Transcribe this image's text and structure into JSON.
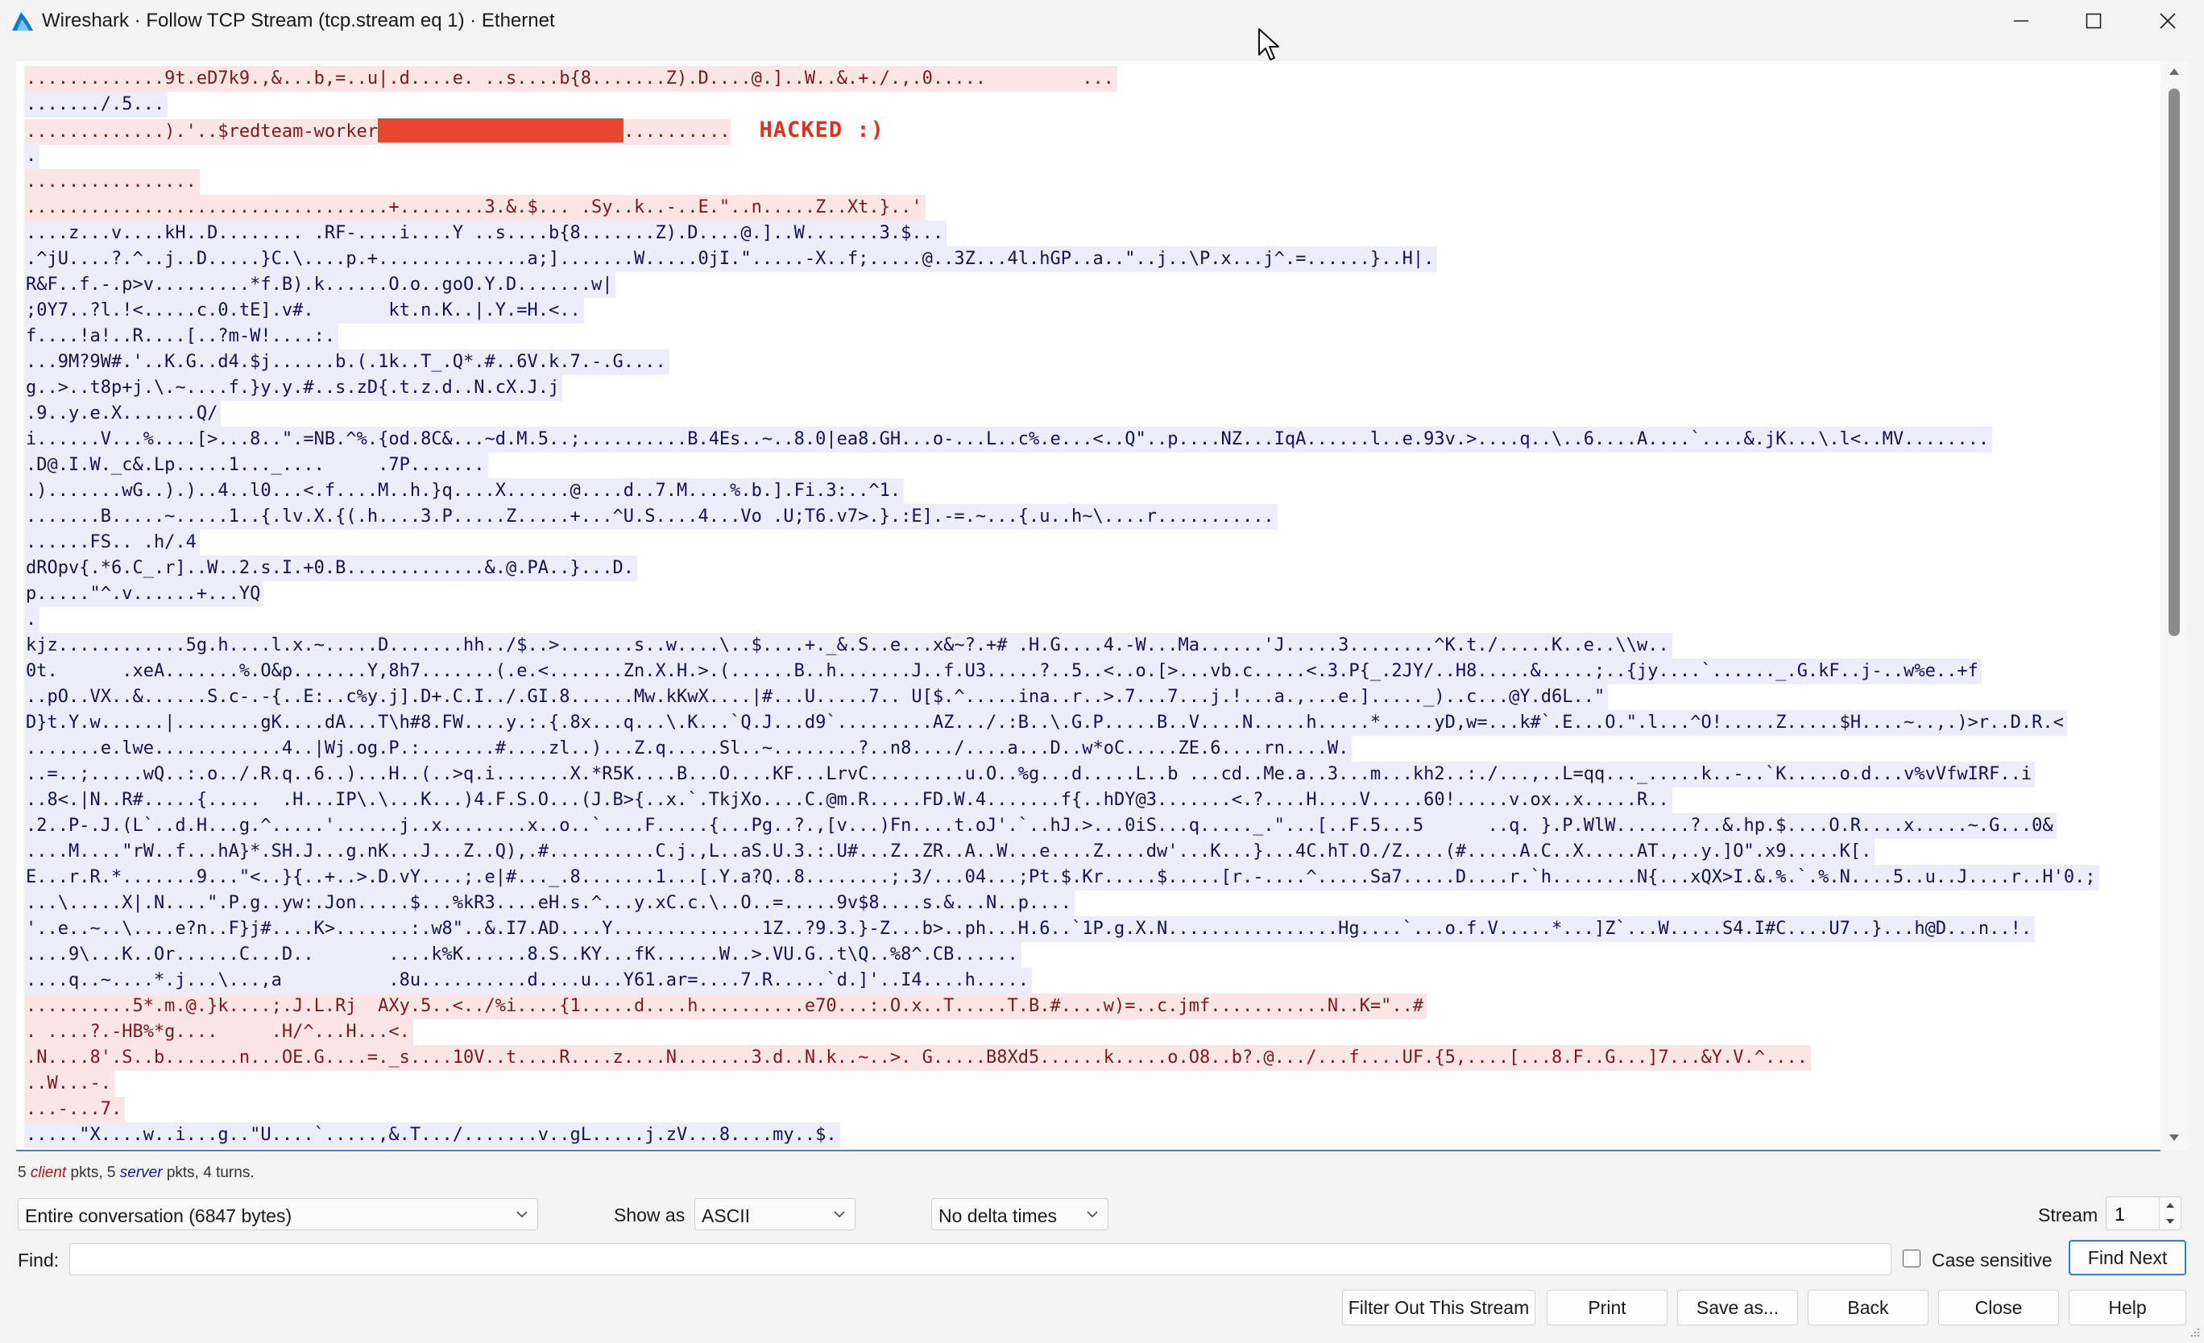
{
  "window": {
    "title": "Wireshark · Follow TCP Stream (tcp.stream eq 1) · Ethernet",
    "icons": [
      "wireshark-fin-icon",
      "minimize-icon",
      "maximize-icon",
      "close-icon"
    ]
  },
  "stream": {
    "hacked_label": "HACKED :)",
    "lines": [
      {
        "dir": "client",
        "text": ".............9t.eD7k9.,&...b,=..u|.d....e. ..s....b{8.......Z).D....@.]..W..&.+./.,.0.....         ..."
      },
      {
        "dir": "server",
        "text": "......./.5..."
      },
      {
        "dir": "client",
        "text": ".............).'..$redteam-worker",
        "redacted": true,
        "after": ".........."
      },
      {
        "dir": "server",
        "text": "."
      },
      {
        "dir": "client",
        "text": "................"
      },
      {
        "dir": "client",
        "text": "..................................+........3.&.$... .Sy..k..-..E.\"..n.....Z..Xt.}..'"
      },
      {
        "dir": "server",
        "text": "....z...v....kH..D........ .RF-....i....Y ..s....b{8.......Z).D....@.]..W.......3.$..."
      },
      {
        "dir": "server",
        "text": ".^jU....?.^..j..D.....}C.\\....p.+..............a;].......W.....0jI.\".....-X..f;.....@..3Z...4l.hGP..a..\"..j..\\P.x...j^.=......}..H|."
      },
      {
        "dir": "server",
        "text": "R&F..f.-.p>v.........*f.B).k......O.o..goO.Y.D.......w|"
      },
      {
        "dir": "server",
        "text": ";0Y7..?l.!<.....c.0.tE].v#.       kt.n.K..|.Y.=H.<.."
      },
      {
        "dir": "server",
        "text": "f....!a!..R....[..?m-W!....:."
      },
      {
        "dir": "server",
        "text": "...9M?9W#.'..K.G..d4.$j......b.(.1k..T_.Q*.#..6V.k.7.-.G...."
      },
      {
        "dir": "server",
        "text": "g..>..t8p+j.\\.~....f.}y.y.#..s.zD{.t.z.d..N.cX.J.j"
      },
      {
        "dir": "server",
        "text": ".9..y.e.X.......Q/"
      },
      {
        "dir": "server",
        "text": "i......V...%....[>...8..\".=NB.^%.{od.8C&...~d.M.5..;..........B.4Es..~..8.0|ea8.GH...o-...L..c%.e...<..Q\"..p....NZ...IqA......l..e.93v.>....q..\\..6....A....`....&.jK...\\.l<..MV........"
      },
      {
        "dir": "server",
        "text": ".D@.I.W._c&.Lp.....1..._....     .7P......."
      },
      {
        "dir": "server",
        "text": ".).......wG..).)..4..l0...<.f....M..h.}q....X......@....d..7.M....%.b.].Fi.3:..^1."
      },
      {
        "dir": "server",
        "text": ".......B.....~.....1..{.lv.X.{(.h....3.P.....Z.....+...^U.S....4...Vo .U;T6.v7>.}.:E].-=.~...{.u..h~\\....r..........."
      },
      {
        "dir": "server",
        "text": "......FS.. .h/.4"
      },
      {
        "dir": "server",
        "text": "dROpv{.*6.C_.r]..W..2.s.I.+0.B.............&.@.PA..}...D."
      },
      {
        "dir": "server",
        "text": "p.....\"^.v......+...YQ"
      },
      {
        "dir": "server",
        "text": "."
      },
      {
        "dir": "server",
        "text": "kjz............5g.h....l.x.~.....D.......hh../$..>.......s..w....\\..$....+._&.S..e...x&~?.+# .H.G....4.-W...Ma......'J.....3........^K.t./.....K..e..\\\\w.."
      },
      {
        "dir": "server",
        "text": "0t.      .xeA.......%.O&p.......Y,8h7.......(.e.<.......Zn.X.H.>.(......B..h.......J..f.U3.....?..5..<..o.[>...vb.c.....<.3.P{_.2JY/..H8.....&.....;..{jy....`......_.G.kF..j-..w%e..+f"
      },
      {
        "dir": "server",
        "text": "..pO..VX..&......S.c-.-{..E:..c%y.j].D+.C.I../.GI.8......Mw.kKwX....|#...U.....7.. U[$.^.....ina..r..>.7...7...j.!...a.,...e.]....._)..c...@Y.d6L..\""
      },
      {
        "dir": "server",
        "text": "D}t.Y.w......|........gK....dA...T\\h#8.FW....y.:.{.8x...q...\\.K...`Q.J...d9`.........AZ.../.:B..\\.G.P.....B..V....N.....h.....*.....yD,w=...k#`.E...O.\".l...^O!.....Z.....$H....~..,.)>r..D.R.<"
      },
      {
        "dir": "server",
        "text": ".......e.lwe............4..|Wj.og.P.:.......#....zl..)...Z.q.....Sl..~........?..n8..../....a...D..w*oC.....ZE.6....rn....W."
      },
      {
        "dir": "server",
        "text": "..=..;.....wQ..:.o../.R.q..6..)...H..(..>q.i.......X.*R5K....B...O....KF...LrvC.........u.O..%g...d.....L..b ...cd..Me.a..3...m...kh2..:./...,..L=qq..._.....k..-..`K.....o.d...v%vVfwIRF..i"
      },
      {
        "dir": "server",
        "text": "..8<.|N..R#.....{.....  .H...IP\\.\\...K...)4.F.S.O...(J.B>{..x.`.TkjXo....C.@m.R.....FD.W.4.......f{..hDY@3.......<.?....H....V.....60!.....v.ox..x.....R.."
      },
      {
        "dir": "server",
        "text": ".2..P-.J.(L`..d.H...g.^.....'......j..x........x..o..`....F.....{...Pg..?.,[v...)Fn....t.oJ'.`..hJ.>...0iS...q....._.\"...[..F.5...5      ..q. }.P.WlW.......?..&.hp.$....O.R....x.....~.G...0&"
      },
      {
        "dir": "server",
        "text": "....M....\"rW..f...hA}*.SH.J...g.nK...J...Z..Q),.#..........C.j.,L..aS.U.3.:.U#...Z..ZR..A..W...e....Z....dw'...K...}...4C.hT.O./Z....(#.....A.C..X.....AT.,..y.]O\".x9.....K[."
      },
      {
        "dir": "server",
        "text": "E...r.R.*.......9...\"<..}{..+..>.D.vY....;.e|#..._.8.......1...[.Y.a?Q..8........;.3/...04...;Pt.$.Kr.....$.....[r.-....^.....Sa7.....D....r.`h........N{...xQX>I.&.%.`.%.N....5..u..J....r..H'0.;"
      },
      {
        "dir": "server",
        "text": "...\\.....X|.N....\".P.g..yw:.Jon.....$...%kR3....eH.s.^...y.xC.c.\\..O..=.....9v$8....s.&...N..p...."
      },
      {
        "dir": "server",
        "text": "'..e..~..\\....e?n..F}j#....K>.......:.w8\"..&.I7.AD....Y..............1Z..?9.3.}-Z...b>..ph...H.6..`1P.g.X.N................Hg....`...o.f.V.....*...]Z`...W.....S4.I#C....U7..}...h@D...n..!."
      },
      {
        "dir": "server",
        "text": "....9\\...K..Or......C...D..       ....k%K......8.S..KY...fK......W..>.VU.G..t\\Q..%8^.CB......"
      },
      {
        "dir": "server",
        "text": "....q..~....*.j...\\...,a          .8u..........d....u...Y61.ar=....7.R.....`d.]'..I4....h....."
      },
      {
        "dir": "client",
        "text": "..........5*.m.@.}k....;.J.L.Rj  AXy.5..<../%i....{1.....d....h..........e70...:.O.x..T.....T.B.#....w)=..c.jmf...........N..K=\"..#"
      },
      {
        "dir": "client",
        "text": ". ....?.-HB%*g....     .H/^...H...<."
      },
      {
        "dir": "client",
        "text": ".N....8'.S..b.......n...OE.G....=._s....10V..t....R....z....N.......3.d..N.k..~..>. G.....B8Xd5......k.....o.O8..b?.@.../...f....UF.{5,....[...8.F..G...]7...&Y.V.^...."
      },
      {
        "dir": "client",
        "text": "..W...-."
      },
      {
        "dir": "client",
        "text": "...-...7."
      },
      {
        "dir": "server",
        "text": ".....\"X....w..i...g..\"U....`.....,&.T.../.......v..gL.....j.zV...8....my..$."
      }
    ]
  },
  "summary": {
    "client_count": "5",
    "client_label": "client",
    "mid": " pkts, ",
    "server_count": "5",
    "server_label": "server",
    "end": " pkts, 4 turns."
  },
  "controls": {
    "conversation": "Entire conversation (6847 bytes)",
    "show_as_label": "Show as",
    "show_as": "ASCII",
    "delta": "No delta times",
    "stream_label": "Stream",
    "stream_value": "1",
    "find_label": "Find:",
    "find_value": "",
    "case_sensitive": "Case sensitive",
    "find_next": "Find Next"
  },
  "buttons": {
    "filter_out": "Filter Out This Stream",
    "print": "Print",
    "save_as": "Save as...",
    "back": "Back",
    "close": "Close",
    "help": "Help"
  },
  "colors": {
    "client_bg": "#fce5e5",
    "client_fg": "#7a1a1a",
    "server_bg": "#ececfb",
    "server_fg": "#14144f",
    "redaction": "#e8452e",
    "hacked": "#e0301e",
    "accent": "#2f7fd0"
  }
}
